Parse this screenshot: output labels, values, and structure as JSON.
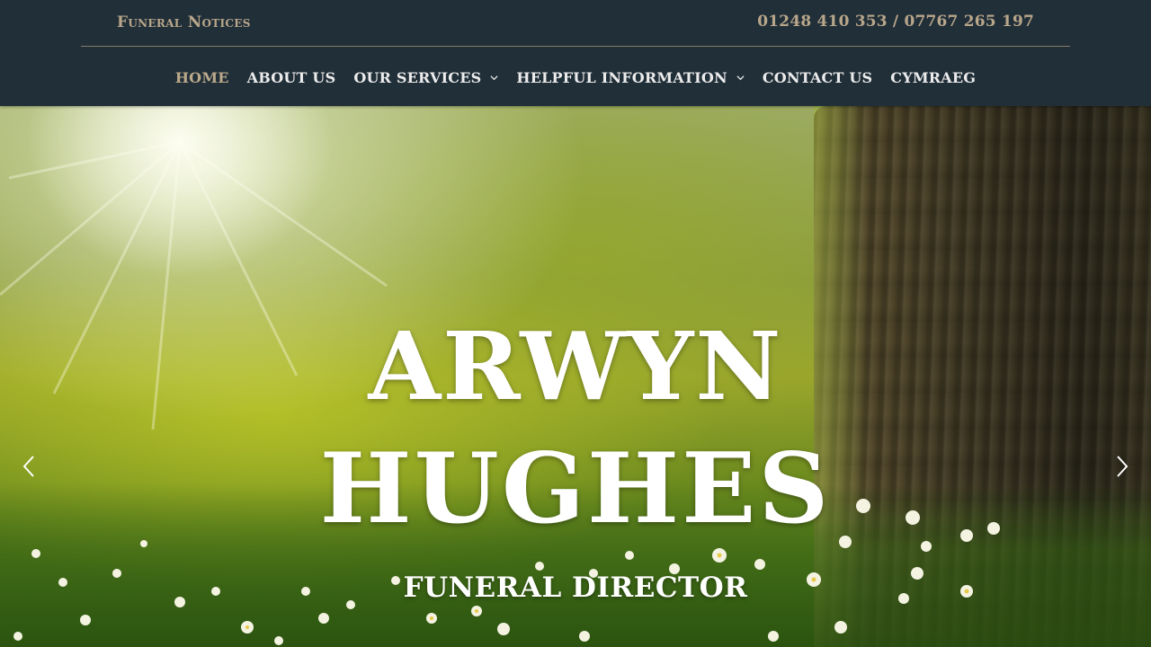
{
  "header": {
    "notices_label": "Funeral Notices",
    "phone": "01248 410 353 / 07767 265 197"
  },
  "nav": {
    "items": [
      {
        "label": "HOME",
        "active": true
      },
      {
        "label": "ABOUT US"
      },
      {
        "label": "OUR SERVICES",
        "dropdown": true
      },
      {
        "label": "HELPFUL INFORMATION",
        "dropdown": true
      },
      {
        "label": "CONTACT US"
      },
      {
        "label": "CYMRAEG"
      }
    ]
  },
  "hero": {
    "title_line1": "ARWYN",
    "title_line2": "HUGHES",
    "subtitle": "FUNERAL DIRECTOR",
    "prev_icon": "chevron-left-icon",
    "next_icon": "chevron-right-icon"
  },
  "colors": {
    "header_bg": "#212f39",
    "accent_gold": "#b8a68a",
    "nav_text": "#ececec"
  }
}
